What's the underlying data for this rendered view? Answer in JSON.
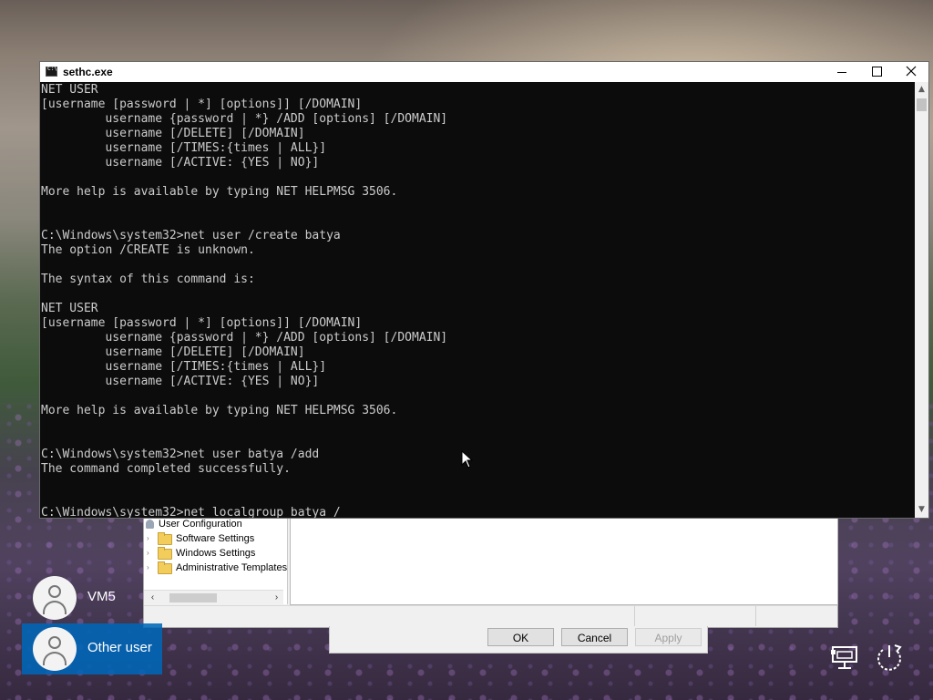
{
  "console": {
    "title": "sethc.exe",
    "lines": "NET USER\n[username [password | *] [options]] [/DOMAIN]\n         username {password | *} /ADD [options] [/DOMAIN]\n         username [/DELETE] [/DOMAIN]\n         username [/TIMES:{times | ALL}]\n         username [/ACTIVE: {YES | NO}]\n\nMore help is available by typing NET HELPMSG 3506.\n\n\nC:\\Windows\\system32>net user /create batya\nThe option /CREATE is unknown.\n\nThe syntax of this command is:\n\nNET USER\n[username [password | *] [options]] [/DOMAIN]\n         username {password | *} /ADD [options] [/DOMAIN]\n         username [/DELETE] [/DOMAIN]\n         username [/TIMES:{times | ALL}]\n         username [/ACTIVE: {YES | NO}]\n\nMore help is available by typing NET HELPMSG 3506.\n\n\nC:\\Windows\\system32>net user batya /add\nThe command completed successfully.\n\n\nC:\\Windows\\system32>net localgroup batya /"
  },
  "policy_editor": {
    "tree_items": [
      {
        "label": "User Configuration",
        "icon": "user-config-icon"
      },
      {
        "label": "Software Settings",
        "icon": "folder-icon"
      },
      {
        "label": "Windows Settings",
        "icon": "folder-icon"
      },
      {
        "label": "Administrative Templates",
        "icon": "folder-icon"
      }
    ]
  },
  "dialog": {
    "ok_label": "OK",
    "cancel_label": "Cancel",
    "apply_label": "Apply"
  },
  "login": {
    "users": [
      {
        "name": "VM5",
        "selected": false
      },
      {
        "name": "Other user",
        "selected": true
      }
    ]
  },
  "system_icons": [
    "network-icon",
    "power-icon"
  ],
  "colors": {
    "console_bg": "#0c0c0c",
    "console_text": "#cccccc",
    "selected_tile": "#0067b8"
  }
}
